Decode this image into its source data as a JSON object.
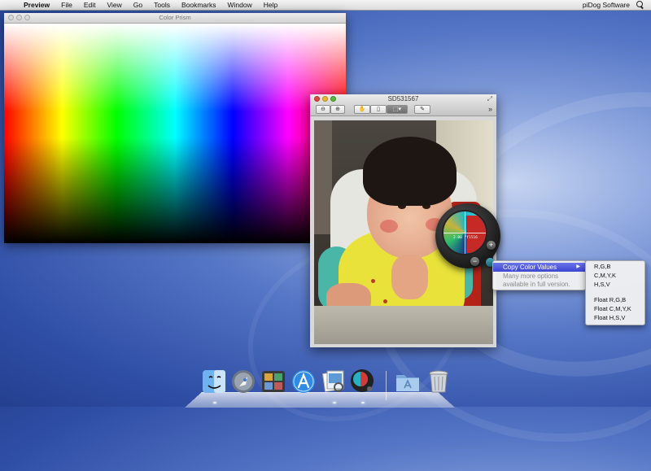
{
  "menubar": {
    "app_name": "Preview",
    "items": [
      "File",
      "Edit",
      "View",
      "Go",
      "Tools",
      "Bookmarks",
      "Window",
      "Help"
    ],
    "vendor": "piDog Software"
  },
  "color_prism_window": {
    "title": "Color Prism"
  },
  "preview_window": {
    "title": "SD531567"
  },
  "loupe": {
    "readout": "2.00 ff1516"
  },
  "context_menu": {
    "copy_color_values": "Copy Color Values",
    "note_line1": "Many more options",
    "note_line2": "available in full version."
  },
  "submenu": {
    "items": [
      "R,G,B",
      "C,M,Y,K",
      "H,S,V",
      "Float R,G,B",
      "Float C,M,Y,K",
      "Float H,S,V"
    ]
  },
  "dock": {
    "items": [
      "finder-icon",
      "launchpad-icon",
      "photo-booth-icon",
      "app-store-icon",
      "preview-icon",
      "color-picker-icon",
      "applications-folder-icon",
      "trash-icon"
    ]
  },
  "colors": {
    "menu_highlight": "#3d46d2",
    "desktop_blue": "#3a5bb5",
    "close_red": "#e2463f",
    "minimize_yellow": "#e7b633",
    "zoom_green": "#5cb741"
  }
}
